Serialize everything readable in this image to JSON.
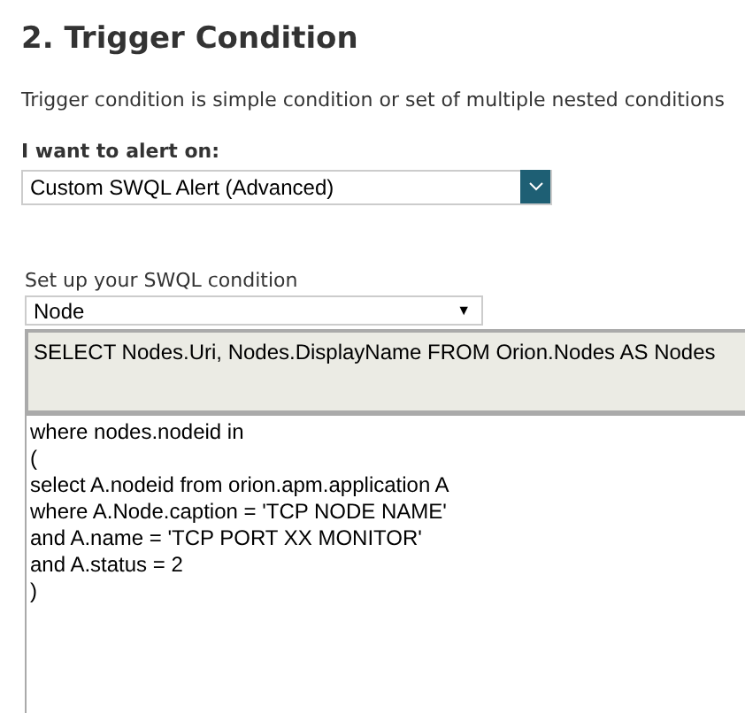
{
  "section": {
    "title": "2. Trigger Condition",
    "description": "Trigger condition is simple condition or set of multiple nested conditions"
  },
  "alert_on": {
    "label": "I want to alert on:",
    "value": "Custom SWQL Alert (Advanced)"
  },
  "swql": {
    "label": "Set up your SWQL condition",
    "object_type": "Node",
    "object_type_arrow": "▼",
    "select_query": "SELECT Nodes.Uri, Nodes.DisplayName FROM Orion.Nodes AS Nodes",
    "where_query": "where nodes.nodeid in\n(\nselect A.nodeid from orion.apm.application A\nwhere A.Node.caption = 'TCP NODE NAME'\nand A.name = 'TCP PORT XX MONITOR'\nand A.status = 2\n)"
  }
}
